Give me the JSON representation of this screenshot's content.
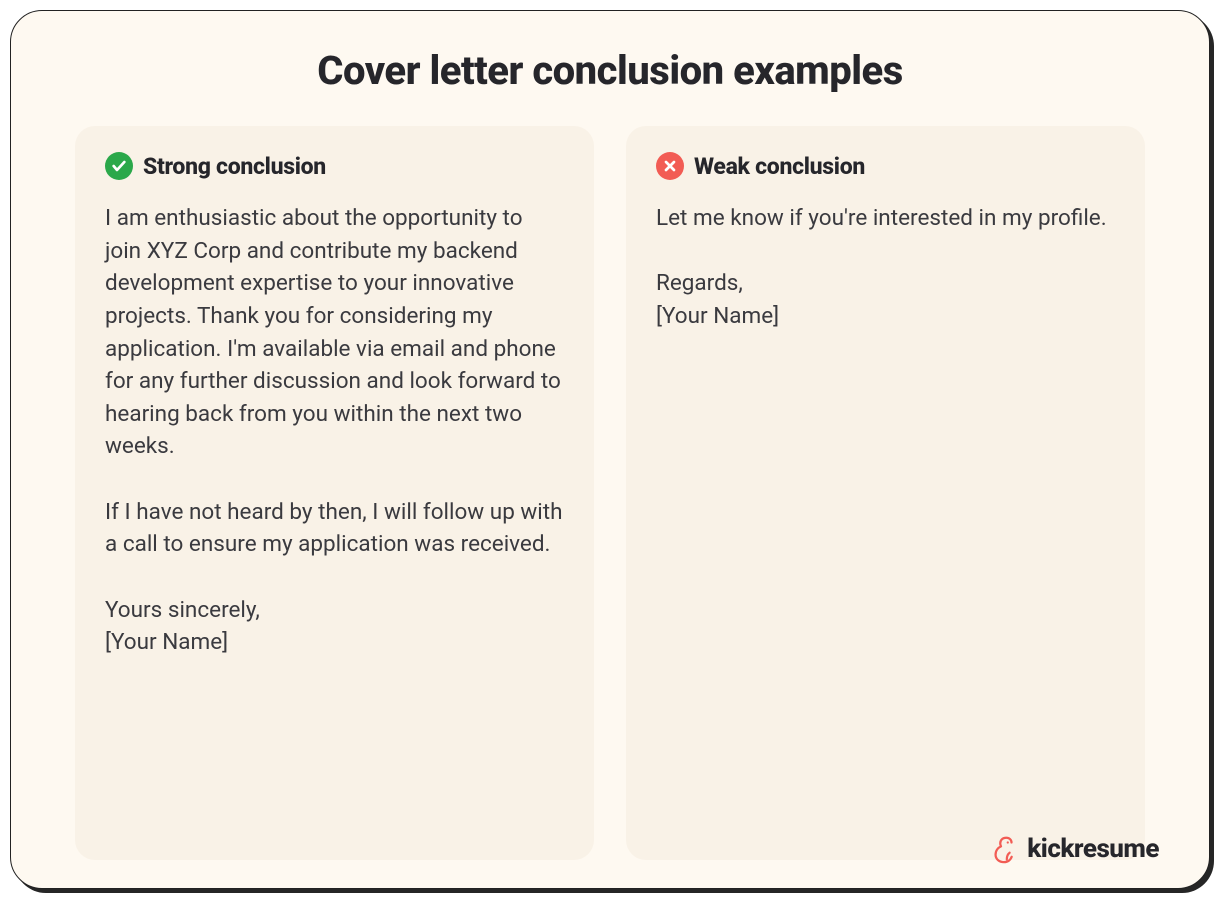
{
  "title": "Cover letter conclusion examples",
  "strong": {
    "label": "Strong conclusion",
    "body": "I am enthusiastic about the opportunity to join XYZ Corp and contribute my backend development expertise to your innovative projects. Thank you for considering my application. I'm available via email and phone for any further discussion and look forward to hearing back from you within the next two weeks.\n\nIf I have not heard by then, I will follow up with a call to ensure my application was received.\n\nYours sincerely,\n[Your Name]"
  },
  "weak": {
    "label": "Weak conclusion",
    "body": "Let me know if you're interested in my profile.\n\nRegards,\n[Your Name]"
  },
  "brand": "kickresume"
}
